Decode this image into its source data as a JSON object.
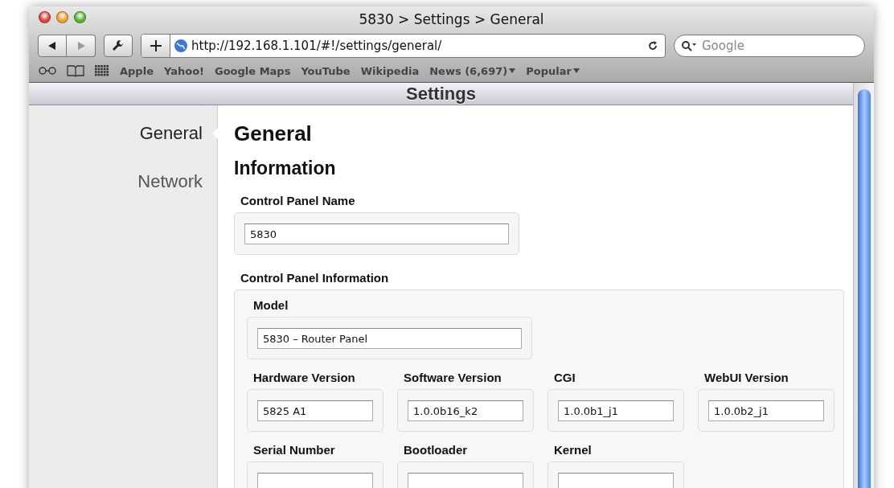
{
  "window": {
    "title": "5830 > Settings > General"
  },
  "toolbar": {
    "url": "http://192.168.1.101/#!/settings/general/",
    "search_placeholder": "Google"
  },
  "bookmarks": [
    {
      "label": "Apple",
      "menu": false
    },
    {
      "label": "Yahoo!",
      "menu": false
    },
    {
      "label": "Google Maps",
      "menu": false
    },
    {
      "label": "YouTube",
      "menu": false
    },
    {
      "label": "Wikipedia",
      "menu": false
    },
    {
      "label": "News (6,697)",
      "menu": true
    },
    {
      "label": "Popular",
      "menu": true
    }
  ],
  "page_header": {
    "title": "Settings"
  },
  "sidebar": {
    "items": [
      {
        "label": "General",
        "selected": true
      },
      {
        "label": "Network",
        "selected": false
      }
    ]
  },
  "main": {
    "heading": "General",
    "section": "Information",
    "name_field": {
      "label": "Control Panel Name",
      "value": "5830"
    },
    "info_group": {
      "title": "Control Panel Information",
      "rows": [
        [
          {
            "label": "Model",
            "value": "5830 – Router Panel"
          }
        ],
        [
          {
            "label": "Hardware Version",
            "value": "5825 A1"
          },
          {
            "label": "Software Version",
            "value": "1.0.0b16_k2"
          },
          {
            "label": "CGI",
            "value": "1.0.0b1_j1"
          },
          {
            "label": "WebUI Version",
            "value": "1.0.0b2_j1"
          }
        ],
        [
          {
            "label": "Serial Number"
          },
          {
            "label": "Bootloader"
          },
          {
            "label": "Kernel"
          }
        ]
      ]
    }
  }
}
